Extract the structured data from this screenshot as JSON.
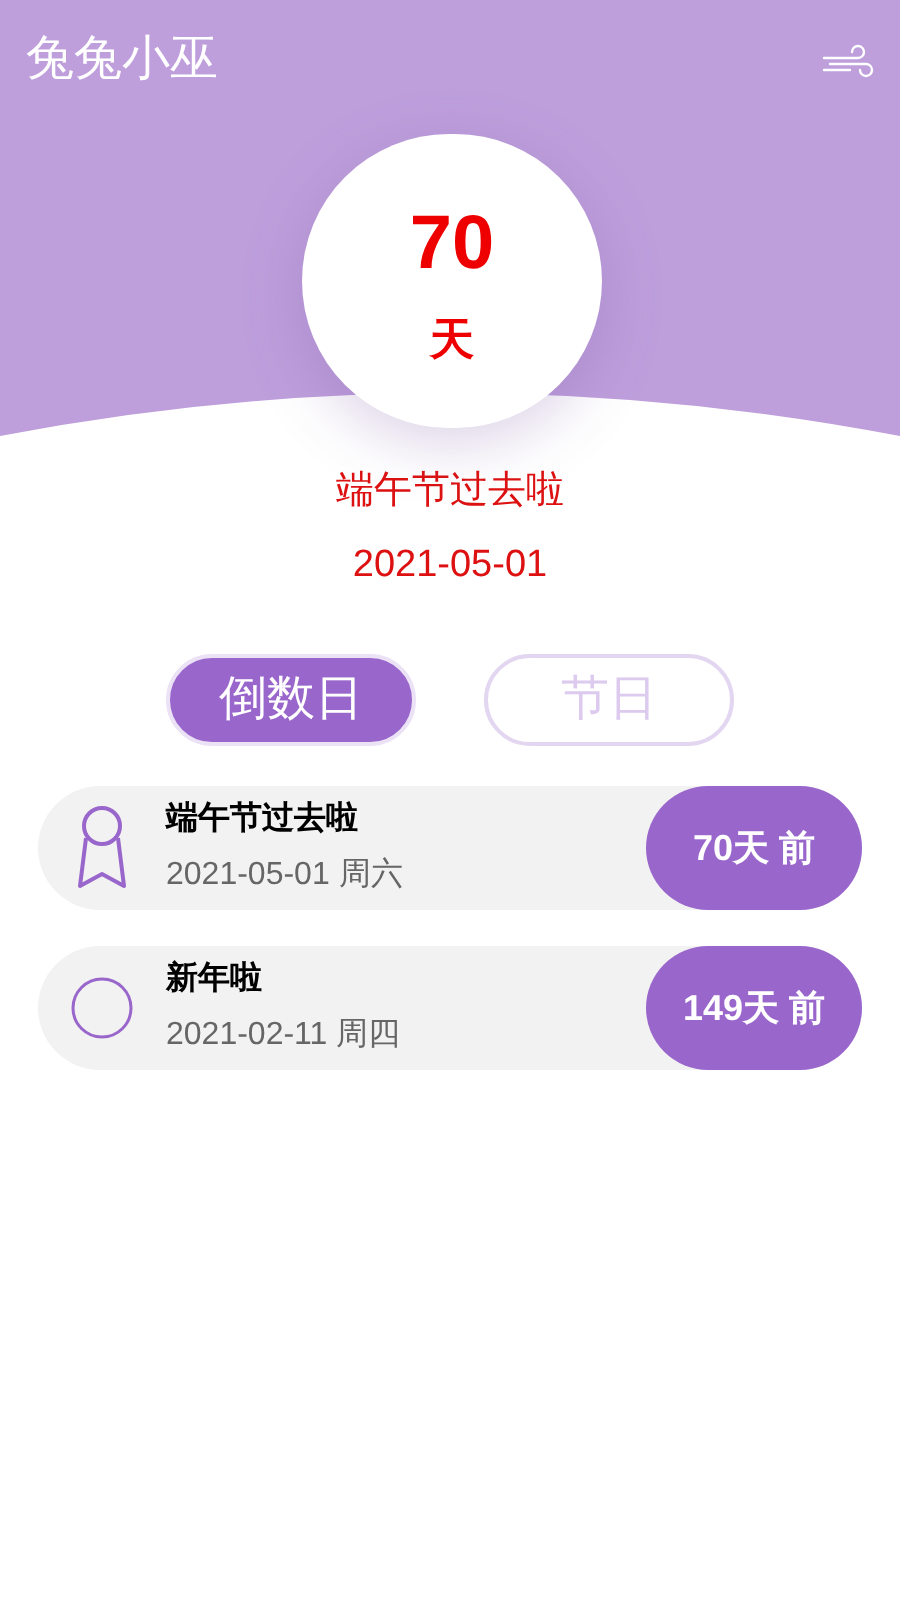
{
  "app_title": "兔兔小巫",
  "counter": {
    "number": "70",
    "unit": "天"
  },
  "featured": {
    "name": "端午节过去啦",
    "date": "2021-05-01"
  },
  "tabs": [
    {
      "label": "倒数日",
      "selected": true
    },
    {
      "label": "节日",
      "selected": false
    }
  ],
  "events": [
    {
      "kind": "ribbon",
      "name": "端午节过去啦",
      "date": "2021-05-01 周六",
      "days": "70天 前"
    },
    {
      "kind": "circle",
      "name": "新年啦",
      "date": "2021-02-11 周四",
      "days": "149天 前"
    }
  ]
}
